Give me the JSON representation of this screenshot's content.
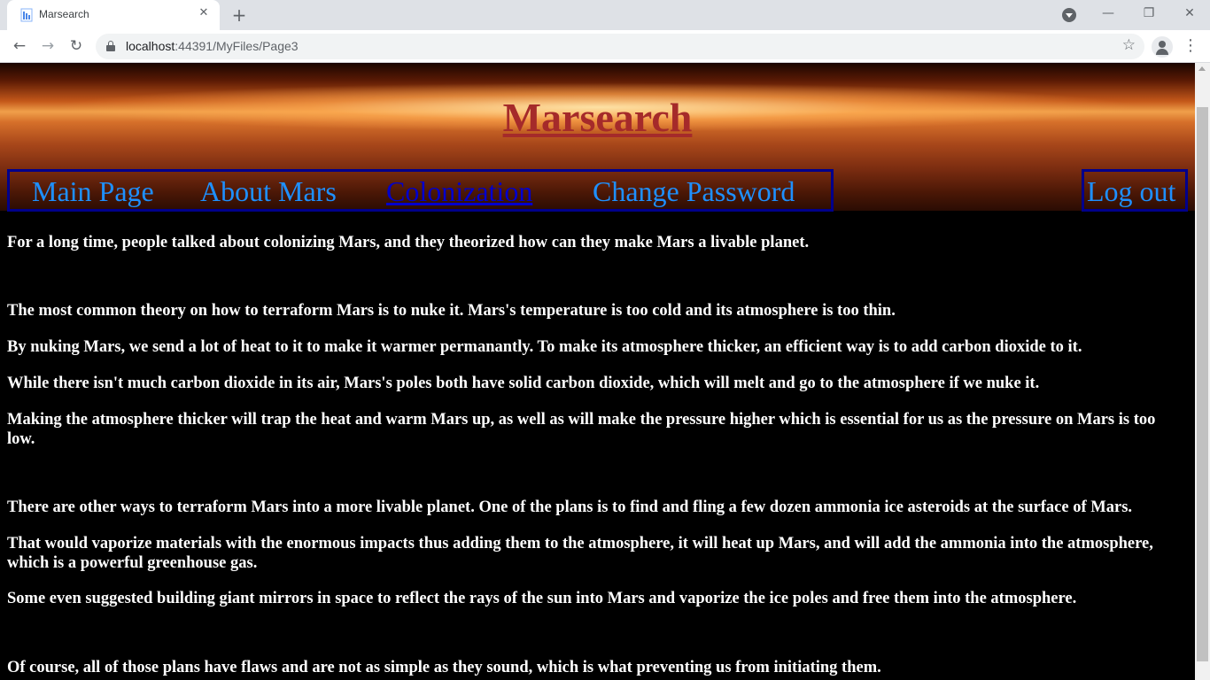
{
  "browser": {
    "tab_title": "Marsearch",
    "tab_close": "✕",
    "new_tab": "+",
    "url_host": "localhost",
    "url_path": ":44391/MyFiles/Page3",
    "minimize": "—",
    "restore": "❐",
    "close": "✕",
    "back": "←",
    "forward": "→",
    "reload": "↻",
    "star": "☆",
    "menu": "⋮"
  },
  "site": {
    "title": "Marsearch"
  },
  "nav": {
    "items": [
      {
        "label": "Main Page"
      },
      {
        "label": "About Mars"
      },
      {
        "label": "Colonization"
      },
      {
        "label": "Change Password"
      }
    ],
    "logout": "Log out"
  },
  "content": {
    "paragraphs": [
      "For a long time, people talked about colonizing Mars, and they theorized how can they make Mars a livable planet.",
      "The most common theory on how to terraform Mars is to nuke it. Mars's temperature is too cold and its atmosphere is too thin.",
      "By nuking Mars, we send a lot of heat to it to make it warmer permanantly. To make its atmosphere thicker, an efficient way is to add carbon dioxide to it.",
      "While there isn't much carbon dioxide in its air, Mars's poles both have solid carbon dioxide, which will melt and go to the atmosphere if we nuke it.",
      "Making the atmosphere thicker will trap the heat and warm Mars up, as well as will make the pressure higher which is essential for us as the pressure on Mars is too low.",
      "There are other ways to terraform Mars into a more livable planet. One of the plans is to find and fling a few dozen ammonia ice asteroids at the surface of Mars.",
      "That would vaporize materials with the enormous impacts thus adding them to the atmosphere, it will heat up Mars, and will add the ammonia into the atmosphere, which is a powerful greenhouse gas.",
      "Some even suggested building giant mirrors in space to reflect the rays of the sun into Mars and vaporize the ice poles and free them into the atmosphere.",
      "Of course, all of those plans have flaws and are not as simple as they sound, which is what preventing us from initiating them."
    ]
  }
}
